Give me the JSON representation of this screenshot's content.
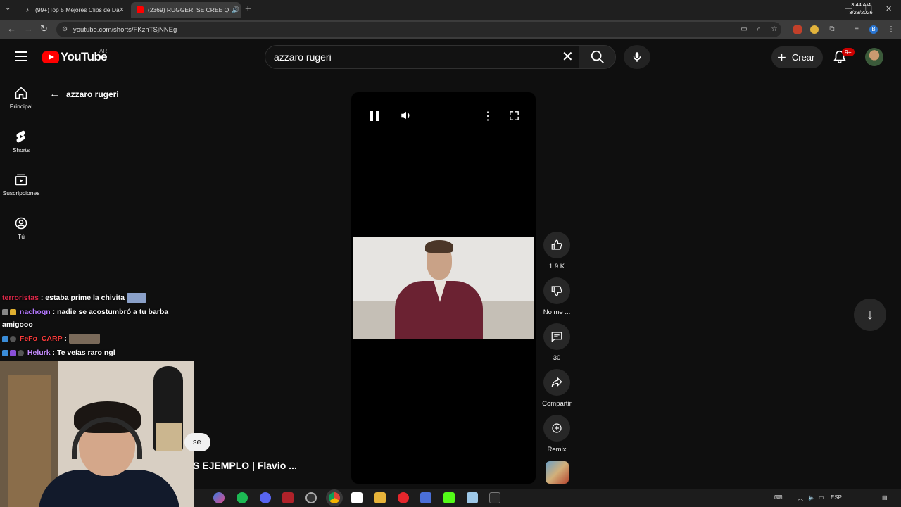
{
  "browser": {
    "tabs": [
      {
        "title": "(99+)Top 5 Mejores Clips de Da",
        "active": false,
        "icon": "tiktok-icon"
      },
      {
        "title": "(2369) RUGGERI SE CREE Q",
        "active": true,
        "icon": "youtube-icon"
      }
    ],
    "url": "youtube.com/shorts/FKzhTSjNNEg"
  },
  "youtube": {
    "logo_text": "YouTube",
    "region": "AR",
    "search_value": "azzaro rugeri",
    "create_label": "Crear",
    "notification_count": "9+",
    "sidebar": [
      {
        "label": "Principal",
        "icon": "home-icon"
      },
      {
        "label": "Shorts",
        "icon": "shorts-icon"
      },
      {
        "label": "Suscripciones",
        "icon": "subscriptions-icon"
      },
      {
        "label": "Tú",
        "icon": "profile-icon"
      }
    ],
    "back_search_label": "azzaro rugeri",
    "actions": {
      "like_count": "1.9 K",
      "dislike_label": "No me ...",
      "comment_count": "30",
      "share_label": "Compartir",
      "remix_label": "Remix"
    },
    "short_title": "S EJEMPLO | Flavio ...",
    "subscribe_partial": "se"
  },
  "stream_overlay": {
    "chat": [
      {
        "user": "terroristas",
        "user_color": "#e0284a",
        "message": ": estaba prime la chivita"
      },
      {
        "user": "nachoqn",
        "user_color": "#b478ff",
        "message": ": nadie se acostumbró a tu barba"
      },
      {
        "user": "",
        "user_color": "#ffffff",
        "message": "amigooo"
      },
      {
        "user": "FeFo_CARP",
        "user_color": "#ff3b3b",
        "message": ":"
      },
      {
        "user": "Helurk",
        "user_color": "#c58cff",
        "message": ": Te veías raro ngl"
      }
    ]
  },
  "taskbar": {
    "language": "ESP",
    "time": "3:44 AM",
    "date": "3/23/2026"
  }
}
